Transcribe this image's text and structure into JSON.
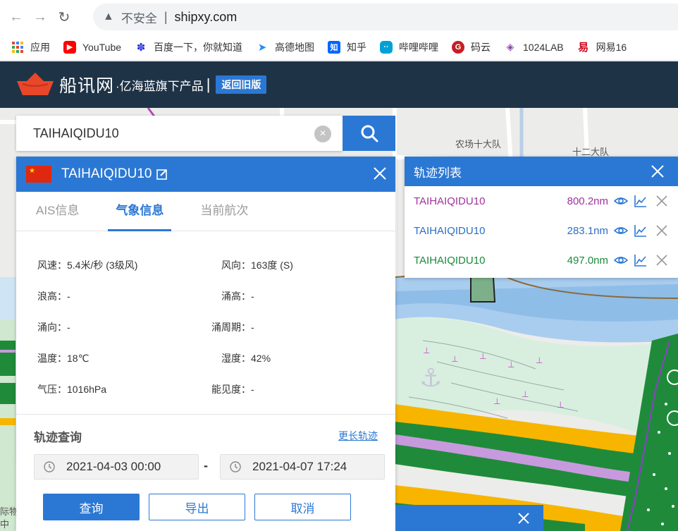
{
  "browser": {
    "insecure_label": "不安全",
    "url": "shipxy.com",
    "bookmarks": [
      {
        "label": "应用",
        "icon": "apps-grid-icon"
      },
      {
        "label": "YouTube",
        "icon": "youtube-icon",
        "color": "#ff0000"
      },
      {
        "label": "百度一下，你就知道",
        "icon": "baidu-paw-icon",
        "color": "#2932e1"
      },
      {
        "label": "高德地图",
        "icon": "amap-icon",
        "color": "#1f8cff"
      },
      {
        "label": "知乎",
        "icon": "zhihu-icon",
        "color": "#0066ff"
      },
      {
        "label": "哔哩哔哩",
        "icon": "bilibili-icon",
        "color": "#00a1d6"
      },
      {
        "label": "码云",
        "icon": "gitee-icon",
        "color": "#c71d23"
      },
      {
        "label": "1024LAB",
        "icon": "1024lab-icon",
        "color": "#8e44ad"
      },
      {
        "label": "网易16",
        "icon": "netease-icon",
        "color": "#d0021b"
      }
    ]
  },
  "header": {
    "brand": "船讯网",
    "brand_sub": "·亿海蓝旗下产品",
    "divider": "|",
    "old_version_button": "返回旧版"
  },
  "search": {
    "value": "TAIHAIQIDU10"
  },
  "ship": {
    "name": "TAIHAIQIDU10",
    "flag": "china-flag",
    "tabs": [
      "AIS信息",
      "气象信息",
      "当前航次"
    ],
    "active_tab": "气象信息",
    "weather": {
      "wind_speed": "风速：5.4米/秒 (3级风)",
      "wind_direction": "风向：163度 (S)",
      "wave_height": "浪高：-",
      "swell_height": "涌高：-",
      "swell_direction": "涌向：-",
      "swell_period": "涌周期：-",
      "temperature": "温度：18℃",
      "humidity": "湿度：42%",
      "pressure": "气压：1016hPa",
      "visibility": "能见度：-"
    }
  },
  "track_query": {
    "title": "轨迹查询",
    "more_link": "更长轨迹",
    "start": "2021-04-03 00:00",
    "separator": "-",
    "end": "2021-04-07 17:24",
    "buttons": {
      "query": "查询",
      "export": "导出",
      "cancel": "取消"
    }
  },
  "track_list": {
    "title": "轨迹列表",
    "items": [
      {
        "name": "TAIHAIQIDU10",
        "distance": "800.2nm",
        "color": "#a0329c"
      },
      {
        "name": "TAIHAIQIDU10",
        "distance": "283.1nm",
        "color": "#2b6fc4"
      },
      {
        "name": "TAIHAIQIDU10",
        "distance": "497.0nm",
        "color": "#1a8a3a"
      }
    ]
  },
  "map": {
    "labels": [
      "农场十大队",
      "十二大队",
      "际物",
      "中"
    ]
  },
  "colors": {
    "accent": "#2b78d4",
    "header_bg": "#1f3347"
  }
}
